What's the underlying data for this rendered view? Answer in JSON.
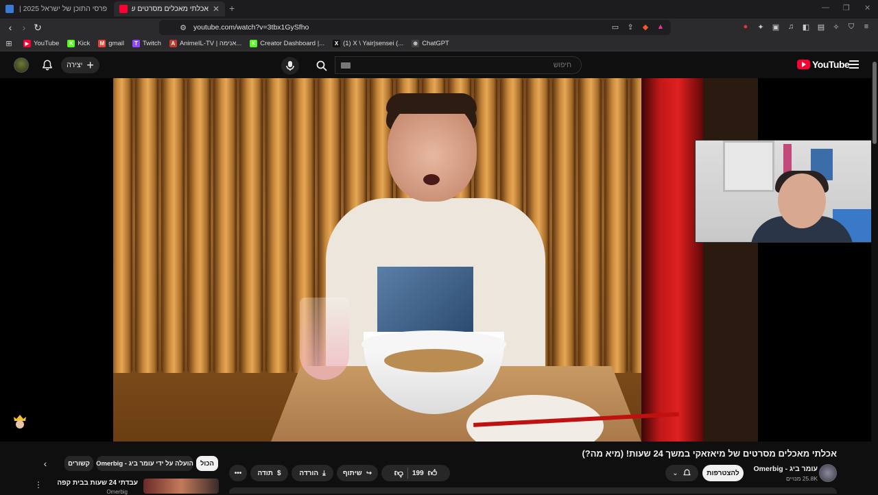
{
  "browser": {
    "tabs": [
      {
        "title": "פרסי התוכן של ישראל 2025 | הצביעו"
      },
      {
        "title": "אכלתי מאכלים מסרטים של מיאז"
      }
    ],
    "url": "youtube.com/watch?v=3tbx1GySfho",
    "bookmarks": [
      {
        "label": "YouTube",
        "color": "#ff0033",
        "glyph": "▶"
      },
      {
        "label": "Kick",
        "color": "#53fc18",
        "glyph": "K"
      },
      {
        "label": "gmail",
        "color": "#ea4335",
        "glyph": "M"
      },
      {
        "label": "Twitch",
        "color": "#9146ff",
        "glyph": "T"
      },
      {
        "label": "AnimeIL-TV | אנימה...",
        "color": "#c0392b",
        "glyph": "A"
      },
      {
        "label": "Creator Dashboard |...",
        "color": "#53fc18",
        "glyph": "K"
      },
      {
        "label": "(1) X \\ Yair|sensei (...",
        "color": "#111111",
        "glyph": "X"
      },
      {
        "label": "ChatGPT",
        "color": "#444444",
        "glyph": "⊛"
      }
    ]
  },
  "youtube": {
    "create_label": "יצירה",
    "search_placeholder": "חיפוש",
    "logo_text": "YouTube",
    "brand_color": "#ff0033"
  },
  "video": {
    "title": "אכלתי מאכלים מסרטים של מיאזאקי במשך 24 שעות! (מיא מה?)",
    "channel_name": "עומר ביג - Omerbig",
    "subscribers": "25.8K מנויים",
    "subscribe_label": "להצטרפות",
    "likes": "199",
    "share_label": "שיתוף",
    "download_label": "הורדה",
    "thanks_label": "תודה"
  },
  "chips": [
    {
      "label": "הכול",
      "active": true
    },
    {
      "label": "הועלה על ידי עומר ביג - Omerbig",
      "active": false
    },
    {
      "label": "קשורים",
      "active": false
    }
  ],
  "recommendation": {
    "title": "עבדתי 24 שעות בבית קפה",
    "channel": "Omerbig"
  }
}
